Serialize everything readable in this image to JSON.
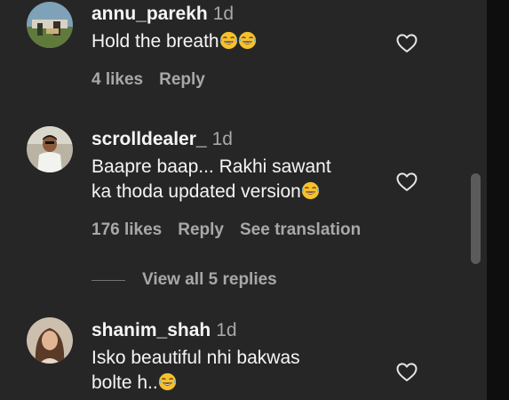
{
  "comments": [
    {
      "username": "annu_parekh",
      "time": "1d",
      "text_lines": [
        "Hold the breath"
      ],
      "likes": "4 likes",
      "reply": "Reply"
    },
    {
      "username": "scrolldealer_",
      "time": "1d",
      "text_lines": [
        "Baapre baap... Rakhi sawant",
        "ka thoda updated version"
      ],
      "likes": "176 likes",
      "reply": "Reply",
      "translation": "See translation"
    },
    {
      "username": "shanim_shah",
      "time": "1d",
      "text_lines": [
        "Isko beautiful nhi bakwas",
        "bolte h.."
      ]
    }
  ],
  "view_replies": "View all 5 replies",
  "icons": {
    "heart": "heart-outline-icon",
    "emoji": "face-with-tears-of-joy-emoji"
  },
  "colors": {
    "background": "#262626",
    "primary_text": "#f5f5f5",
    "secondary_text": "#a8a8a8"
  }
}
